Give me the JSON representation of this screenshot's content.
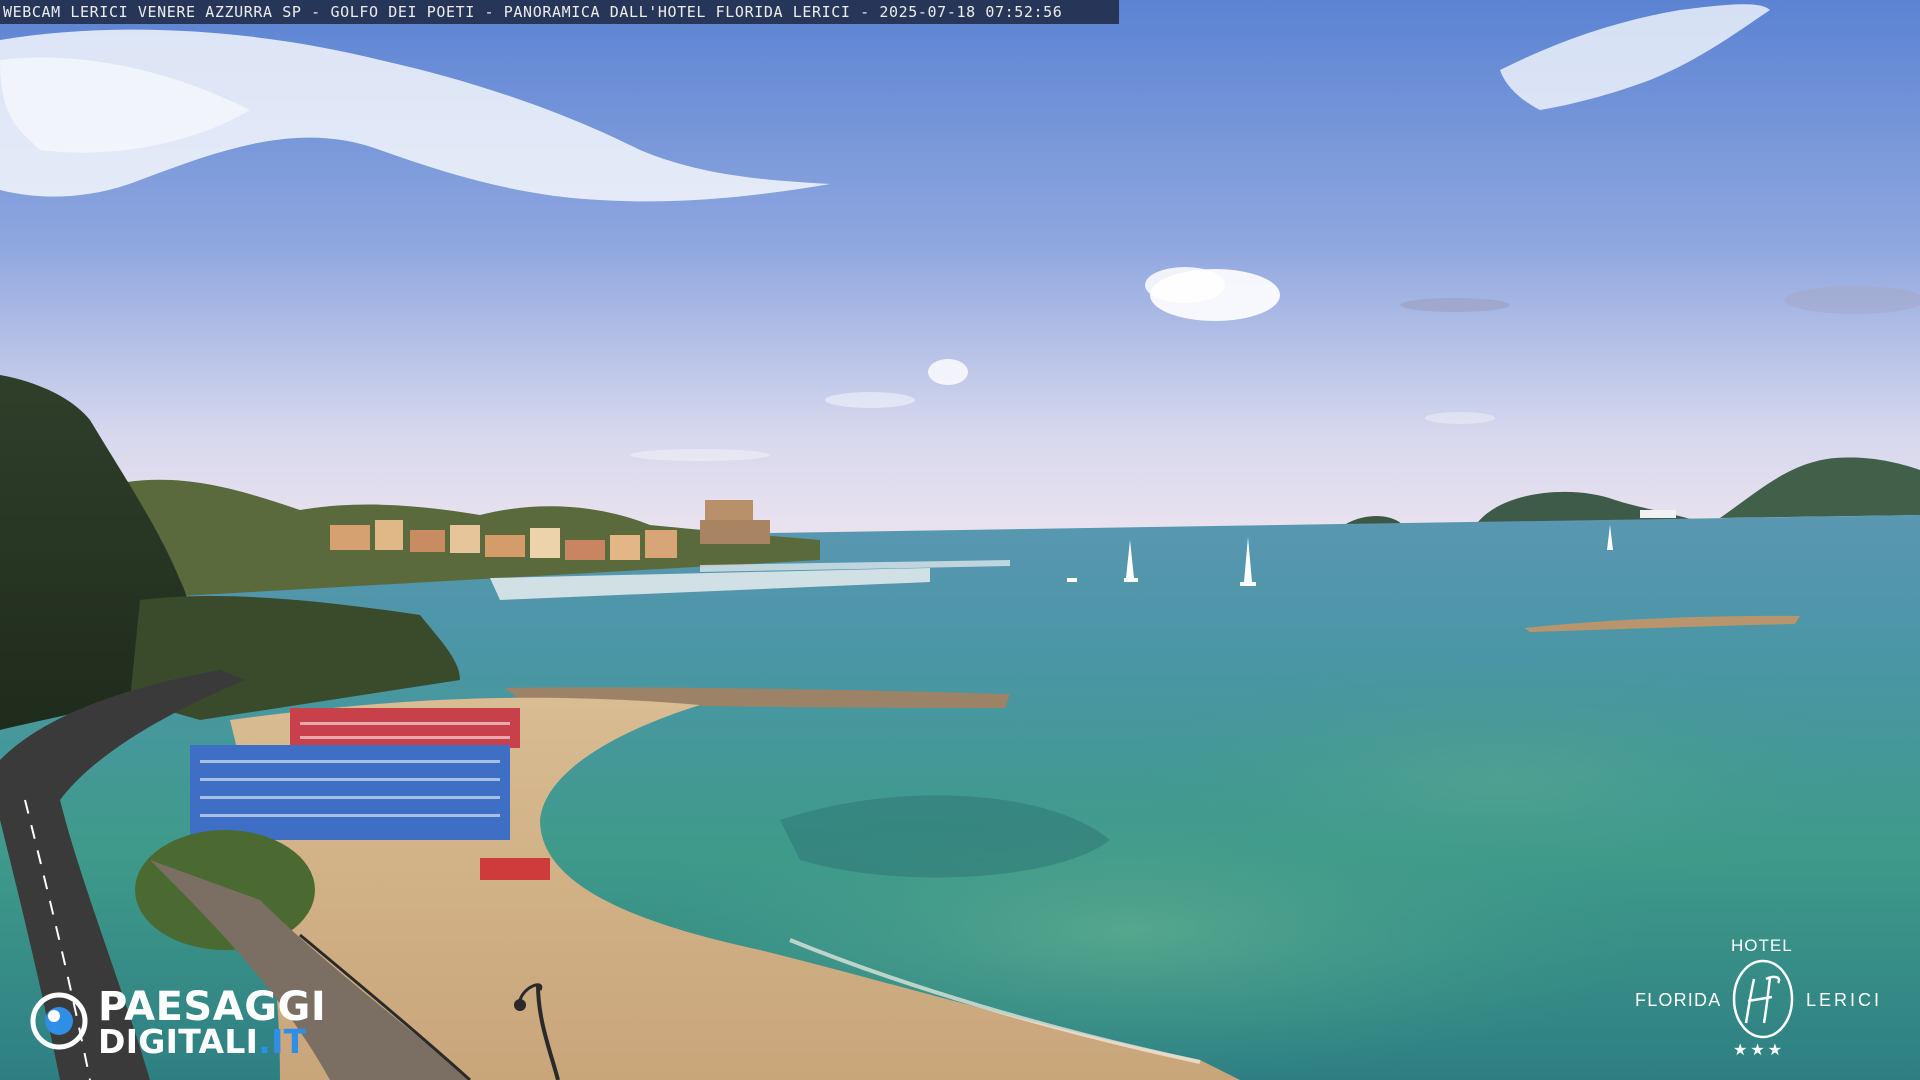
{
  "caption": "WEBCAM LERICI VENERE AZZURRA SP - GOLFO DEI POETI - PANORAMICA DALL'HOTEL FLORIDA LERICI - 2025-07-18 07:52:56",
  "paesaggi_logo": {
    "line1": "PAESAGGI",
    "line2_main": "DIGITALI",
    "line2_suffix": ".IT"
  },
  "hotel_logo": {
    "top": "HOTEL",
    "left": "FLORIDA",
    "right": "LERICI",
    "stars": "★★★"
  },
  "colors": {
    "sky_top": "#5d84d4",
    "sky_horizon": "#e6e2ef",
    "sea_far": "#4f9ab0",
    "sea_near": "#3f9a86",
    "sand": "#d8b98c",
    "accent_blue": "#2f8fe6"
  }
}
